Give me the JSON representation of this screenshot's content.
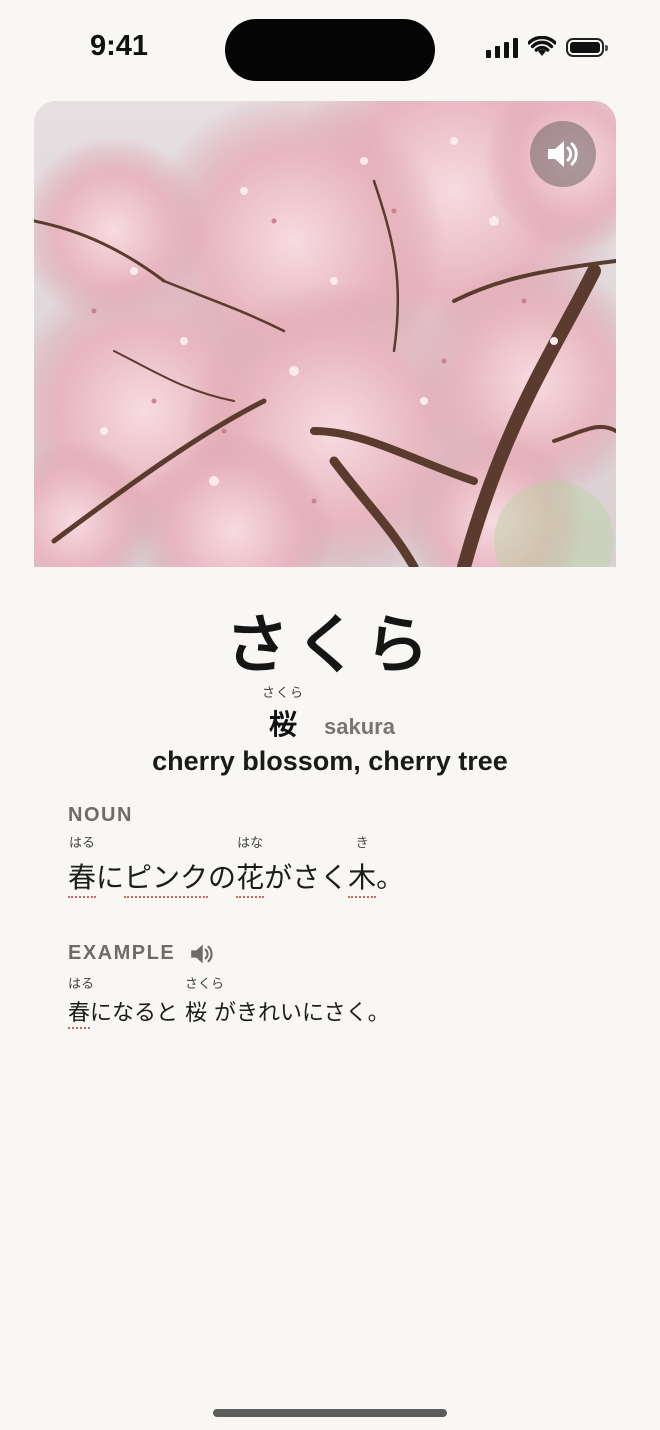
{
  "status_bar": {
    "time": "9:41"
  },
  "word": {
    "kana": "さくら",
    "kanji_furigana": "さくら",
    "kanji": "桜",
    "romaji": "sakura",
    "meaning": "cherry blossom, cherry tree"
  },
  "definition": {
    "label": "NOUN",
    "segments": [
      {
        "text": "春",
        "furigana": "はる"
      },
      {
        "text": "に"
      },
      {
        "text": "ピンク"
      },
      {
        "text": "の"
      },
      {
        "text": "花",
        "furigana": "はな"
      },
      {
        "text": "がさく"
      },
      {
        "text": "木",
        "furigana": "き"
      },
      {
        "text": "。"
      }
    ]
  },
  "example": {
    "label": "EXAMPLE",
    "segments": [
      {
        "text": "春",
        "furigana": "はる"
      },
      {
        "text": "になると "
      },
      {
        "text": "桜",
        "furigana": "さくら"
      },
      {
        "text": " がきれいにさく。"
      }
    ]
  },
  "icons": {
    "hero_audio": "speaker-icon",
    "example_audio": "speaker-icon"
  },
  "colors": {
    "background": "#f9f7f4",
    "underline": "#c96a5f",
    "blossom": "#e9b9c0"
  }
}
